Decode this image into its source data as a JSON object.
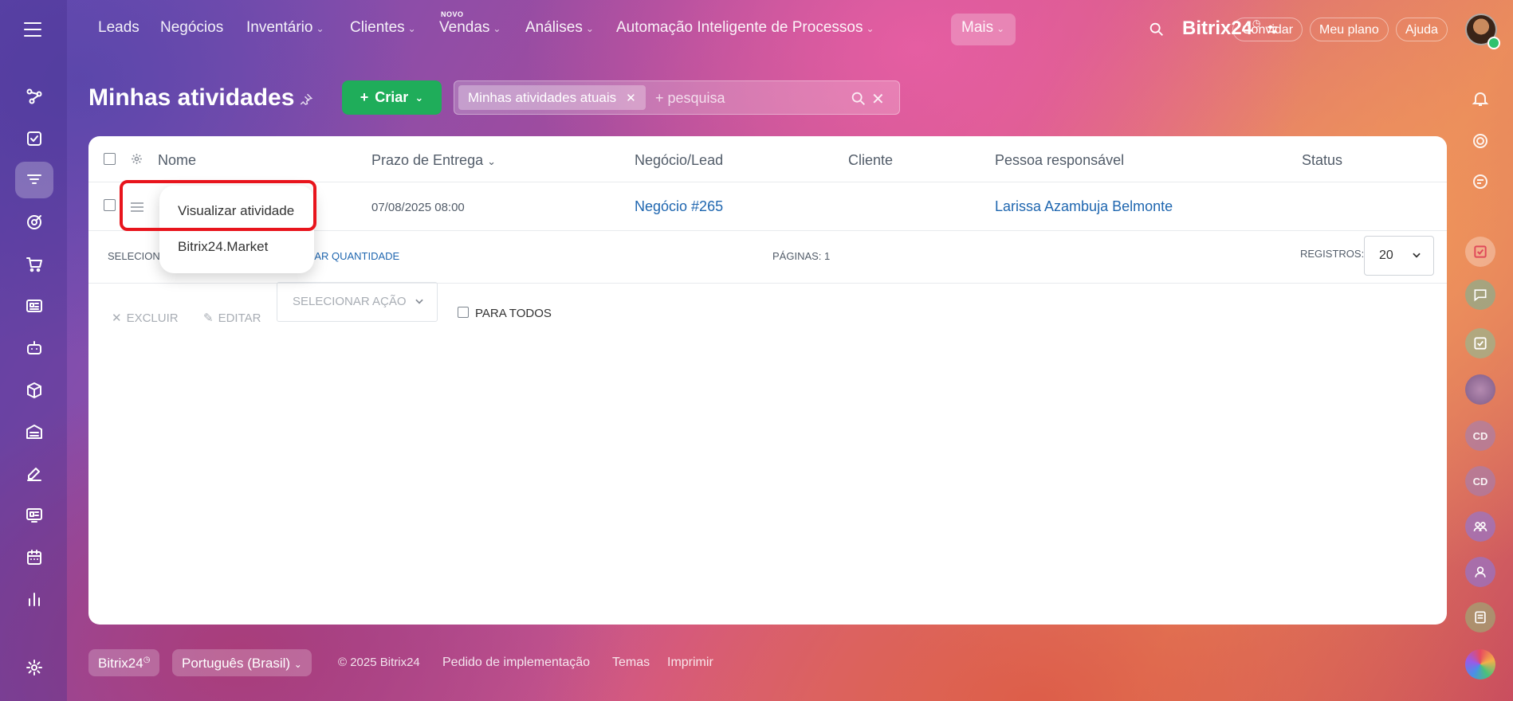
{
  "topnav": {
    "items": [
      {
        "label": "Leads",
        "chevron": false
      },
      {
        "label": "Negócios",
        "chevron": false
      },
      {
        "label": "Inventário",
        "chevron": true
      },
      {
        "label": "Clientes",
        "chevron": true
      },
      {
        "label": "Vendas",
        "chevron": true,
        "badge": "NOVO"
      },
      {
        "label": "Análises",
        "chevron": true
      },
      {
        "label": "Automação Inteligente de Processos",
        "chevron": true
      },
      {
        "label": "Mais",
        "chevron": true
      }
    ],
    "brand": "Bitrix24",
    "buttons": {
      "invite": "Convidar",
      "plan": "Meu plano",
      "help": "Ajuda"
    }
  },
  "header": {
    "title": "Minhas atividades",
    "create_label": "Criar",
    "filter_chip": "Minhas atividades atuais",
    "search_placeholder": "+ pesquisa"
  },
  "table": {
    "columns": [
      "Nome",
      "Prazo de Entrega",
      "Negócio/Lead",
      "Cliente",
      "Pessoa responsável",
      "Status"
    ],
    "rows": [
      {
        "nome": "",
        "prazo": "07/08/2025 08:00",
        "negocio": "Negócio #265",
        "cliente": "",
        "responsavel": "Larissa Azambuja Belmonte",
        "status": ""
      }
    ]
  },
  "grid_footer": {
    "selected_label": "SELECIONA",
    "show_count": "TRAR QUANTIDADE",
    "pages": "PÁGINAS: 1",
    "records_label": "REGISTROS:",
    "records_value": "20"
  },
  "actions": {
    "delete": "EXCLUIR",
    "edit": "EDITAR",
    "select_action": "SELECIONAR AÇÃO",
    "for_all": "PARA TODOS"
  },
  "popup": {
    "items": [
      "Visualizar atividade",
      "Bitrix24.Market"
    ]
  },
  "footer": {
    "brand_chip": "Bitrix24",
    "language": "Português (Brasil)",
    "copyright": "© 2025 Bitrix24",
    "links": [
      "Pedido de implementação",
      "Temas",
      "Imprimir"
    ]
  },
  "right_bar": {
    "initials": [
      "CD",
      "CD"
    ]
  },
  "colors": {
    "create_button": "#1fad5a",
    "link": "#2067b0",
    "highlight": "#e8141c"
  }
}
